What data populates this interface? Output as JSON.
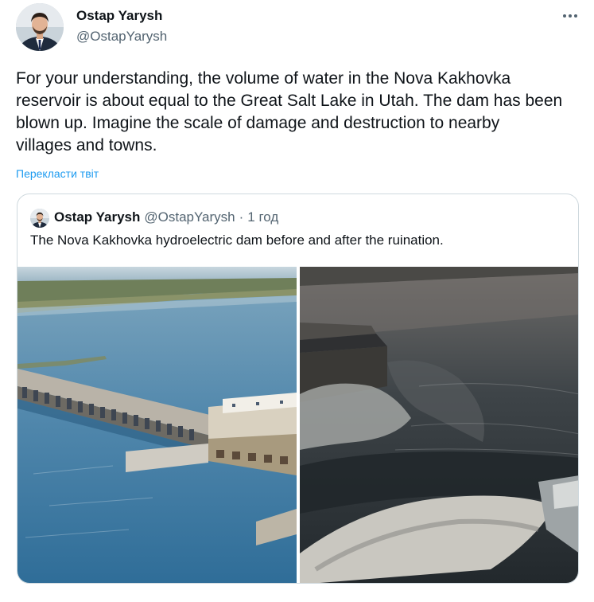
{
  "author": {
    "name": "Ostap Yarysh",
    "handle": "@OstapYarysh"
  },
  "tweet": {
    "text": "For your understanding, the volume of water in the Nova Kakhovka\nreservoir is about equal to the Great Salt Lake in Utah. The dam has been\nblown up. Imagine the scale of damage and destruction to nearby\nvillages and towns.",
    "translate_label": "Перекласти твіт"
  },
  "quote": {
    "name": "Ostap Yarysh",
    "handle": "@OstapYarysh",
    "separator": "·",
    "time": "1 год",
    "text": "The Nova Kakhovka hydroelectric dam before and after the ruination."
  },
  "icons": {
    "more": "more-horizontal-icon"
  },
  "colors": {
    "link": "#1d9bf0",
    "secondary_text": "#536471",
    "border": "#cfd9de"
  }
}
